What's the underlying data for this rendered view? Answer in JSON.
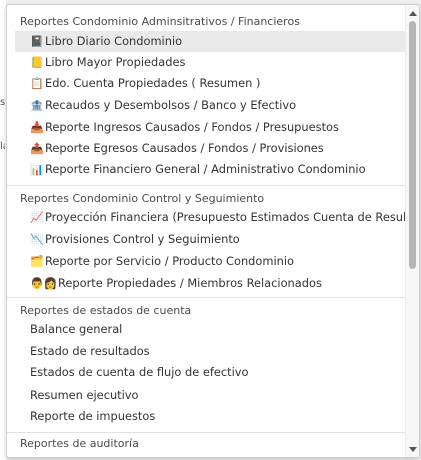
{
  "background": {
    "fragment_a": "s",
    "fragment_b": "la"
  },
  "groups": [
    {
      "header": "Reportes Condominio Adminsitrativos / Financieros",
      "items": [
        {
          "icon": "📓",
          "label": "Libro Diario Condominio"
        },
        {
          "icon": "📒",
          "label": "Libro Mayor Propiedades"
        },
        {
          "icon": "📋",
          "label": "Edo. Cuenta Propiedades ( Resumen )"
        },
        {
          "icon": "🏦",
          "label": "Recaudos y Desembolsos / Banco y Efectivo"
        },
        {
          "icon": "📥",
          "label": "Reporte Ingresos Causados / Fondos / Presupuestos"
        },
        {
          "icon": "📤",
          "label": "Reporte Egresos Causados / Fondos / Provisiones"
        },
        {
          "icon": "📊",
          "label": "Reporte Financiero General / Administrativo Condominio"
        }
      ]
    },
    {
      "header": "Reportes Condominio Control y Seguimiento",
      "items": [
        {
          "icon": "📈",
          "label": "Proyección Financiera (Presupuesto Estimados Cuenta de Resultado)"
        },
        {
          "icon": "📉",
          "label": "Provisiones Control y Seguimiento"
        },
        {
          "icon": "🗂️",
          "label": "Reporte por Servicio / Producto Condominio"
        },
        {
          "icon": "👨👩",
          "label": "Reporte Propiedades / Miembros Relacionados"
        }
      ]
    },
    {
      "header": "Reportes de estados de cuenta",
      "items": [
        {
          "label": "Balance general"
        },
        {
          "label": "Estado de resultados"
        },
        {
          "label": "Estados de cuenta de flujo de efectivo"
        },
        {
          "label": "Resumen ejecutivo"
        },
        {
          "label": "Reporte de impuestos"
        }
      ]
    },
    {
      "header": "Reportes de auditoría",
      "items": []
    }
  ]
}
